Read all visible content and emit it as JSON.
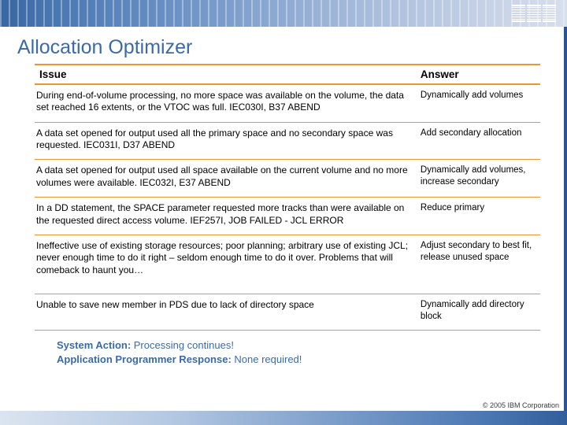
{
  "brand": {
    "logo": "IBM"
  },
  "title": "Allocation Optimizer",
  "table": {
    "head": {
      "issue": "Issue",
      "answer": "Answer"
    },
    "rows": [
      {
        "issue": "During end-of-volume processing, no more space was available on the volume, the data set reached 16 extents, or the VTOC was full.   IEC030I, B37 ABEND",
        "answer": "Dynamically add volumes"
      },
      {
        "issue": "A data set opened for output used all the primary space and no secondary space was requested. IEC031I, D37 ABEND",
        "answer": "Add secondary allocation"
      },
      {
        "issue": "A data set opened for output used all space available on the current volume and no more volumes were available. IEC032I, E37 ABEND",
        "answer": "Dynamically add volumes, increase secondary"
      },
      {
        "issue": "In a DD statement, the SPACE parameter requested more tracks than were available on the requested direct access volume. IEF257I, JOB FAILED - JCL ERROR",
        "answer": "Reduce primary"
      },
      {
        "issue": "Ineffective use of existing storage resources; poor planning; arbitrary use of existing JCL; never enough time to do it right – seldom enough time to do it over.  Problems that will comeback to haunt you…",
        "answer": "Adjust secondary to best fit, release unused space"
      },
      {
        "issue": "Unable to save new member in PDS due to lack of directory space",
        "answer": "Dynamically add directory block"
      }
    ]
  },
  "notes": {
    "sa_label": "System Action: ",
    "sa_text": "Processing continues!",
    "apr_label": "Application Programmer Response: ",
    "apr_text": "None required!"
  },
  "copyright": "© 2005 IBM Corporation"
}
